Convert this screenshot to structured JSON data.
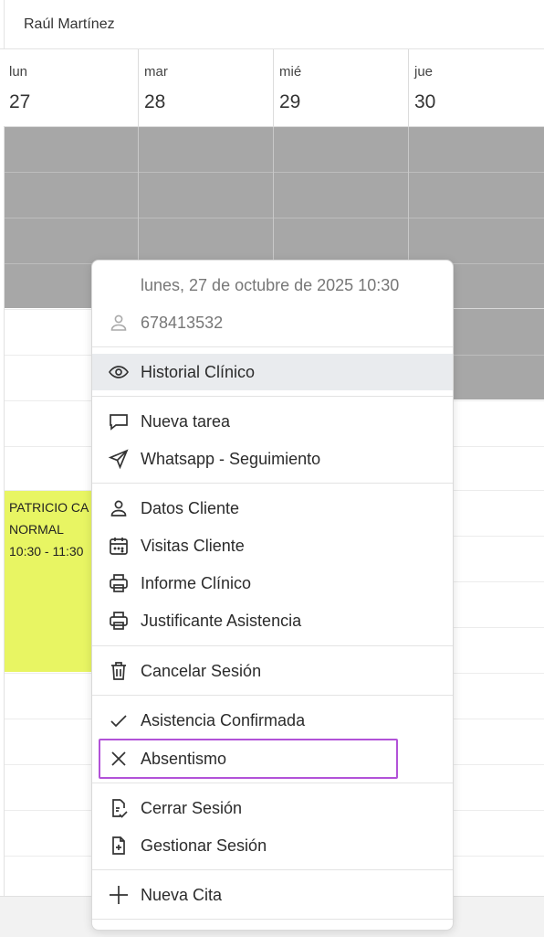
{
  "header": {
    "person_name": "Raúl Martínez"
  },
  "days": [
    {
      "name": "lun",
      "number": "27"
    },
    {
      "name": "mar",
      "number": "28"
    },
    {
      "name": "mié",
      "number": "29"
    },
    {
      "name": "jue",
      "number": "30"
    }
  ],
  "appointment": {
    "patient": "PATRICIO CA",
    "type": "NORMAL",
    "time": "10:30 - 11:30",
    "color": "#e8f563"
  },
  "context_menu": {
    "datetime": "lunes, 27 de octubre de 2025 10:30",
    "phone": "678413532",
    "groups": [
      [
        {
          "label": "Historial Clínico",
          "icon": "eye-icon"
        }
      ],
      [
        {
          "label": "Nueva tarea",
          "icon": "chat-bubble-icon"
        },
        {
          "label": "Whatsapp - Seguimiento",
          "icon": "send-icon"
        }
      ],
      [
        {
          "label": "Datos Cliente",
          "icon": "person-icon"
        },
        {
          "label": "Visitas Cliente",
          "icon": "calendar-icon"
        },
        {
          "label": "Informe Clínico",
          "icon": "printer-icon"
        },
        {
          "label": "Justificante Asistencia",
          "icon": "printer-icon"
        }
      ],
      [
        {
          "label": "Cancelar Sesión",
          "icon": "trash-icon"
        }
      ],
      [
        {
          "label": "Asistencia Confirmada",
          "icon": "check-icon"
        },
        {
          "label": "Absentismo",
          "icon": "x-icon"
        }
      ],
      [
        {
          "label": "Cerrar Sesión",
          "icon": "document-check-icon"
        },
        {
          "label": "Gestionar Sesión",
          "icon": "document-plus-icon"
        }
      ],
      [
        {
          "label": "Nueva Cita",
          "icon": "plus-icon"
        }
      ]
    ]
  },
  "colors": {
    "highlight": "#b252d8",
    "blocked_slot": "#a7a7a7",
    "hover": "#e9ebee"
  }
}
